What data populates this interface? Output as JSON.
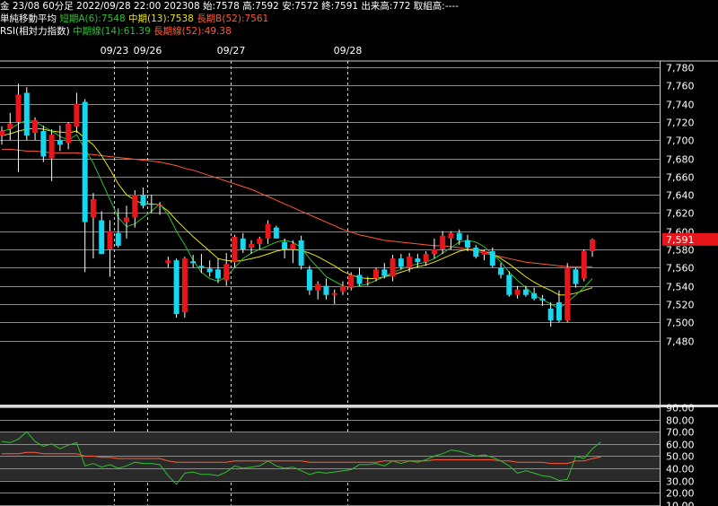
{
  "header": {
    "line1": "金 23/08 60分足 2022/09/28 22:00 202308 始:7578 高:7592 安:7572 終:7591 出来高:772 取組高:----",
    "ma_title": "単純移動平均",
    "ma_short": "短期A(6):7548",
    "ma_mid": "中期(13):7538",
    "ma_long": "長期B(52):7561",
    "rsi_title": "RSI(相対力指数)",
    "rsi_mid": "中期線(14):61.39",
    "rsi_long": "長期線(52):49.38"
  },
  "colors": {
    "up": "#e8151b",
    "down": "#15d7f0",
    "ma_short": "#2ec12e",
    "ma_mid": "#e8e800",
    "ma_long": "#ff5a36",
    "current_price_bg": "#e8151b"
  },
  "chart_data": [
    {
      "type": "candlestick",
      "title": "金 23/08 60分足",
      "ylim": [
        7470,
        7790
      ],
      "y_ticks": [
        "7,780",
        "7,760",
        "7,740",
        "7,720",
        "7,700",
        "7,680",
        "7,660",
        "7,640",
        "7,620",
        "7,600",
        "7,580",
        "7,560",
        "7,540",
        "7,520",
        "7,500",
        "7,480"
      ],
      "date_labels": [
        {
          "label": "09/23",
          "index": 14
        },
        {
          "label": "09/26",
          "index": 18
        },
        {
          "label": "09/27",
          "index": 28
        },
        {
          "label": "09/28",
          "index": 42
        }
      ],
      "current_price": "7,591",
      "candles": [
        {
          "o": 7705,
          "h": 7715,
          "l": 7695,
          "c": 7710
        },
        {
          "o": 7712,
          "h": 7730,
          "l": 7700,
          "c": 7718
        },
        {
          "o": 7720,
          "h": 7762,
          "l": 7665,
          "c": 7750
        },
        {
          "o": 7752,
          "h": 7758,
          "l": 7700,
          "c": 7705
        },
        {
          "o": 7708,
          "h": 7725,
          "l": 7700,
          "c": 7722
        },
        {
          "o": 7710,
          "h": 7716,
          "l": 7676,
          "c": 7682
        },
        {
          "o": 7680,
          "h": 7712,
          "l": 7655,
          "c": 7706
        },
        {
          "o": 7700,
          "h": 7716,
          "l": 7688,
          "c": 7695
        },
        {
          "o": 7697,
          "h": 7720,
          "l": 7690,
          "c": 7718
        },
        {
          "o": 7715,
          "h": 7752,
          "l": 7708,
          "c": 7740
        },
        {
          "o": 7742,
          "h": 7745,
          "l": 7555,
          "c": 7610
        },
        {
          "o": 7615,
          "h": 7642,
          "l": 7570,
          "c": 7635
        },
        {
          "o": 7612,
          "h": 7622,
          "l": 7575,
          "c": 7575
        },
        {
          "o": 7580,
          "h": 7612,
          "l": 7550,
          "c": 7600
        },
        {
          "o": 7598,
          "h": 7625,
          "l": 7582,
          "c": 7584
        },
        {
          "o": 7610,
          "h": 7628,
          "l": 7592,
          "c": 7615
        },
        {
          "o": 7615,
          "h": 7645,
          "l": 7604,
          "c": 7640
        },
        {
          "o": 7640,
          "h": 7648,
          "l": 7625,
          "c": 7628
        },
        {
          "o": 7630,
          "h": 7640,
          "l": 7620,
          "c": 7629
        },
        {
          "o": 7628,
          "h": 7632,
          "l": 7618,
          "c": 7629
        },
        {
          "o": 7565,
          "h": 7572,
          "l": 7560,
          "c": 7568
        },
        {
          "o": 7568,
          "h": 7570,
          "l": 7505,
          "c": 7509
        },
        {
          "o": 7511,
          "h": 7572,
          "l": 7505,
          "c": 7570
        },
        {
          "o": 7567,
          "h": 7574,
          "l": 7560,
          "c": 7565
        },
        {
          "o": 7562,
          "h": 7575,
          "l": 7554,
          "c": 7560
        },
        {
          "o": 7559,
          "h": 7568,
          "l": 7550,
          "c": 7555
        },
        {
          "o": 7558,
          "h": 7570,
          "l": 7543,
          "c": 7548
        },
        {
          "o": 7546,
          "h": 7576,
          "l": 7540,
          "c": 7564
        },
        {
          "o": 7566,
          "h": 7596,
          "l": 7560,
          "c": 7594
        },
        {
          "o": 7592,
          "h": 7598,
          "l": 7576,
          "c": 7580
        },
        {
          "o": 7582,
          "h": 7590,
          "l": 7575,
          "c": 7586
        },
        {
          "o": 7586,
          "h": 7594,
          "l": 7580,
          "c": 7592
        },
        {
          "o": 7592,
          "h": 7612,
          "l": 7586,
          "c": 7608
        },
        {
          "o": 7604,
          "h": 7606,
          "l": 7592,
          "c": 7592
        },
        {
          "o": 7588,
          "h": 7592,
          "l": 7570,
          "c": 7580
        },
        {
          "o": 7580,
          "h": 7590,
          "l": 7565,
          "c": 7586
        },
        {
          "o": 7590,
          "h": 7595,
          "l": 7558,
          "c": 7562
        },
        {
          "o": 7558,
          "h": 7562,
          "l": 7530,
          "c": 7535
        },
        {
          "o": 7535,
          "h": 7545,
          "l": 7525,
          "c": 7542
        },
        {
          "o": 7540,
          "h": 7548,
          "l": 7525,
          "c": 7530
        },
        {
          "o": 7530,
          "h": 7536,
          "l": 7520,
          "c": 7532
        },
        {
          "o": 7534,
          "h": 7545,
          "l": 7530,
          "c": 7540
        },
        {
          "o": 7538,
          "h": 7555,
          "l": 7535,
          "c": 7552
        },
        {
          "o": 7552,
          "h": 7560,
          "l": 7540,
          "c": 7542
        },
        {
          "o": 7544,
          "h": 7550,
          "l": 7540,
          "c": 7545
        },
        {
          "o": 7548,
          "h": 7560,
          "l": 7545,
          "c": 7558
        },
        {
          "o": 7558,
          "h": 7565,
          "l": 7548,
          "c": 7551
        },
        {
          "o": 7550,
          "h": 7574,
          "l": 7545,
          "c": 7570
        },
        {
          "o": 7570,
          "h": 7575,
          "l": 7558,
          "c": 7561
        },
        {
          "o": 7560,
          "h": 7576,
          "l": 7555,
          "c": 7572
        },
        {
          "o": 7570,
          "h": 7575,
          "l": 7560,
          "c": 7566
        },
        {
          "o": 7566,
          "h": 7578,
          "l": 7562,
          "c": 7575
        },
        {
          "o": 7575,
          "h": 7592,
          "l": 7570,
          "c": 7580
        },
        {
          "o": 7580,
          "h": 7600,
          "l": 7575,
          "c": 7595
        },
        {
          "o": 7592,
          "h": 7600,
          "l": 7580,
          "c": 7598
        },
        {
          "o": 7598,
          "h": 7602,
          "l": 7585,
          "c": 7590
        },
        {
          "o": 7590,
          "h": 7596,
          "l": 7578,
          "c": 7582
        },
        {
          "o": 7582,
          "h": 7585,
          "l": 7570,
          "c": 7572
        },
        {
          "o": 7574,
          "h": 7580,
          "l": 7568,
          "c": 7578
        },
        {
          "o": 7578,
          "h": 7582,
          "l": 7560,
          "c": 7562
        },
        {
          "o": 7560,
          "h": 7565,
          "l": 7548,
          "c": 7552
        },
        {
          "o": 7552,
          "h": 7556,
          "l": 7528,
          "c": 7530
        },
        {
          "o": 7530,
          "h": 7540,
          "l": 7526,
          "c": 7536
        },
        {
          "o": 7536,
          "h": 7540,
          "l": 7528,
          "c": 7530
        },
        {
          "o": 7532,
          "h": 7538,
          "l": 7524,
          "c": 7526
        },
        {
          "o": 7526,
          "h": 7530,
          "l": 7518,
          "c": 7524
        },
        {
          "o": 7515,
          "h": 7522,
          "l": 7495,
          "c": 7502
        },
        {
          "o": 7522,
          "h": 7535,
          "l": 7500,
          "c": 7502
        },
        {
          "o": 7502,
          "h": 7565,
          "l": 7500,
          "c": 7560
        },
        {
          "o": 7558,
          "h": 7560,
          "l": 7538,
          "c": 7542
        },
        {
          "o": 7548,
          "h": 7580,
          "l": 7545,
          "c": 7578
        },
        {
          "o": 7578,
          "h": 7592,
          "l": 7572,
          "c": 7591
        }
      ],
      "ma_short": [
        7710,
        7712,
        7718,
        7722,
        7720,
        7715,
        7710,
        7704,
        7700,
        7706,
        7690,
        7675,
        7655,
        7635,
        7615,
        7605,
        7608,
        7615,
        7622,
        7630,
        7618,
        7600,
        7585,
        7568,
        7555,
        7548,
        7545,
        7550,
        7560,
        7570,
        7576,
        7580,
        7584,
        7588,
        7590,
        7588,
        7582,
        7570,
        7560,
        7550,
        7545,
        7540,
        7538,
        7540,
        7542,
        7546,
        7550,
        7555,
        7558,
        7562,
        7564,
        7566,
        7570,
        7576,
        7582,
        7588,
        7590,
        7588,
        7583,
        7575,
        7566,
        7555,
        7546,
        7538,
        7530,
        7525,
        7520,
        7515,
        7522,
        7530,
        7538,
        7548
      ],
      "ma_mid": [
        7705,
        7707,
        7710,
        7712,
        7713,
        7712,
        7710,
        7709,
        7708,
        7710,
        7702,
        7695,
        7683,
        7668,
        7652,
        7640,
        7634,
        7630,
        7630,
        7629,
        7622,
        7612,
        7603,
        7594,
        7586,
        7578,
        7570,
        7568,
        7567,
        7568,
        7570,
        7572,
        7575,
        7578,
        7580,
        7580,
        7579,
        7576,
        7572,
        7567,
        7562,
        7556,
        7552,
        7549,
        7548,
        7548,
        7550,
        7552,
        7555,
        7558,
        7561,
        7563,
        7566,
        7570,
        7574,
        7578,
        7580,
        7580,
        7578,
        7575,
        7570,
        7564,
        7557,
        7550,
        7544,
        7539,
        7535,
        7530,
        7530,
        7532,
        7535,
        7538
      ],
      "ma_long": [
        7690,
        7690,
        7689,
        7688,
        7688,
        7687,
        7686,
        7686,
        7686,
        7686,
        7685,
        7684,
        7683,
        7682,
        7681,
        7680,
        7679,
        7678,
        7677,
        7676,
        7674,
        7672,
        7669,
        7667,
        7664,
        7661,
        7658,
        7655,
        7652,
        7649,
        7646,
        7642,
        7638,
        7634,
        7630,
        7626,
        7622,
        7618,
        7614,
        7610,
        7606,
        7602,
        7599,
        7596,
        7594,
        7592,
        7590,
        7589,
        7588,
        7587,
        7586,
        7585,
        7584,
        7584,
        7583,
        7582,
        7580,
        7578,
        7576,
        7574,
        7572,
        7570,
        7568,
        7566,
        7565,
        7564,
        7563,
        7562,
        7561,
        7561,
        7561,
        7561
      ]
    },
    {
      "type": "line",
      "title": "RSI(相対力指数)",
      "ylim": [
        10,
        90
      ],
      "y_ticks": [
        "90.00",
        "80.00",
        "70.00",
        "60.00",
        "50.00",
        "40.00",
        "30.00",
        "20.00",
        "10.00"
      ],
      "series": [
        {
          "name": "中期線(14)",
          "values": [
            62,
            61,
            64,
            70,
            62,
            58,
            60,
            56,
            59,
            61,
            42,
            44,
            41,
            43,
            40,
            42,
            45,
            44,
            44,
            43,
            34,
            27,
            36,
            37,
            35,
            35,
            34,
            37,
            42,
            40,
            41,
            42,
            46,
            42,
            40,
            41,
            38,
            35,
            37,
            36,
            37,
            38,
            39,
            43,
            43,
            44,
            42,
            46,
            44,
            46,
            45,
            47,
            50,
            52,
            55,
            54,
            52,
            50,
            51,
            49,
            46,
            42,
            36,
            38,
            36,
            34,
            33,
            30,
            31,
            50,
            48,
            56,
            61.39
          ]
        },
        {
          "name": "長期線(52)",
          "values": [
            52,
            52,
            52,
            53,
            53,
            52,
            52,
            52,
            52,
            52,
            50,
            50,
            49,
            49,
            48,
            48,
            48,
            48,
            48,
            48,
            46,
            45,
            45,
            45,
            45,
            45,
            45,
            45,
            46,
            46,
            46,
            46,
            46,
            46,
            46,
            46,
            46,
            45,
            45,
            45,
            45,
            45,
            45,
            45,
            45,
            45,
            46,
            46,
            46,
            46,
            46,
            46,
            47,
            47,
            47,
            47,
            47,
            47,
            47,
            47,
            46,
            46,
            45,
            45,
            45,
            45,
            44,
            44,
            44,
            46,
            46,
            48,
            49.38
          ]
        }
      ]
    }
  ]
}
